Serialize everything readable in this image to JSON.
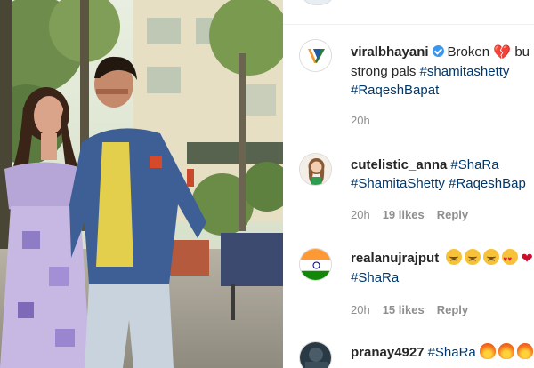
{
  "comments": [
    {
      "username": "viralbhayani",
      "verified": true,
      "text_before": "Broken",
      "emoji": "broken-heart",
      "text_after": "bu",
      "line2_text": "strong pals",
      "tags_line2": "#shamitashetty",
      "line3": "#RaqeshBapat",
      "time": "20h"
    },
    {
      "username": "cutelistic_anna",
      "line1_tag": "#ShaRa",
      "line2": "#ShamitaShetty #RaqeshBap",
      "time": "20h",
      "likes": "19 likes",
      "reply": "Reply"
    },
    {
      "username": "realanujrajput",
      "emojis": [
        "sad-face",
        "sad-face",
        "sad-face",
        "heart-eyes-face",
        "heart"
      ],
      "line2": "#ShaRa",
      "time": "20h",
      "likes": "15 likes",
      "reply": "Reply"
    },
    {
      "username": "pranay4927",
      "line1_tag": "#ShaRa",
      "emojis": [
        "fire",
        "fire",
        "fire"
      ]
    }
  ],
  "colors": {
    "hashtag": "#00376b",
    "meta": "#8e8e8e",
    "verified": "#3897f0"
  }
}
